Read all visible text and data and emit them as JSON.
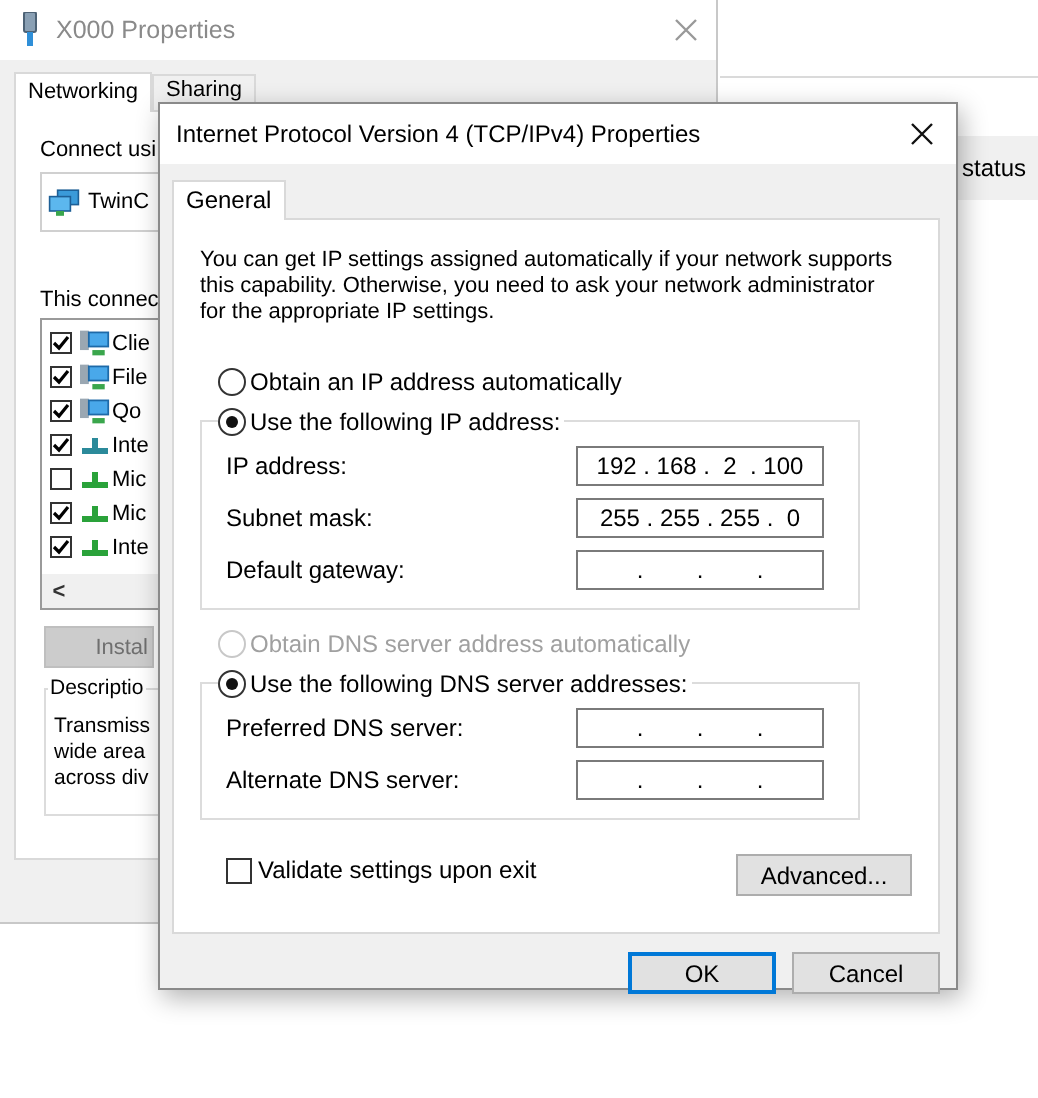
{
  "right_window": {
    "status_text": "status"
  },
  "background_window": {
    "title": "X000 Properties",
    "tabs": [
      {
        "label": "Networking",
        "selected": true
      },
      {
        "label": "Sharing",
        "selected": false
      }
    ],
    "connect_using_label": "Connect usi",
    "adapter": "TwinC",
    "items_label": "This connec",
    "items": [
      {
        "label": "Clie",
        "checked": true,
        "kind": "computer"
      },
      {
        "label": "File",
        "checked": true,
        "kind": "computer"
      },
      {
        "label": "Qo",
        "checked": true,
        "kind": "computer"
      },
      {
        "label": "Inte",
        "checked": true,
        "kind": "network"
      },
      {
        "label": "Mic",
        "checked": false,
        "kind": "network"
      },
      {
        "label": "Mic",
        "checked": true,
        "kind": "network"
      },
      {
        "label": "Inte",
        "checked": true,
        "kind": "network"
      }
    ],
    "scroll_left": "<",
    "install_button": {
      "label": "Instal",
      "disabled": true
    },
    "description": {
      "legend": "Descriptio",
      "lines": [
        "Transmiss",
        "wide area",
        "across div"
      ]
    }
  },
  "dialog": {
    "title": "Internet Protocol Version 4 (TCP/IPv4) Properties",
    "tabs": [
      {
        "label": "General",
        "selected": true
      }
    ],
    "intro": "You can get IP settings assigned automatically if your network supports this capability. Otherwise, you need to ask your network administrator for the appropriate IP settings.",
    "ip_auto": {
      "label": "Obtain an IP address automatically",
      "selected": false,
      "disabled": false
    },
    "ip_manual": {
      "label": "Use the following IP address:",
      "selected": true,
      "disabled": false
    },
    "ip_fields": [
      {
        "label": "IP address:",
        "value": "192 . 168 .  2  . 100"
      },
      {
        "label": "Subnet mask:",
        "value": "255 . 255 . 255 .  0"
      },
      {
        "label": "Default gateway:",
        "value": ".        .        ."
      }
    ],
    "dns_auto": {
      "label": "Obtain DNS server address automatically",
      "selected": false,
      "disabled": true
    },
    "dns_manual": {
      "label": "Use the following DNS server addresses:",
      "selected": true,
      "disabled": false
    },
    "dns_fields": [
      {
        "label": "Preferred DNS server:",
        "value": ".        .        ."
      },
      {
        "label": "Alternate DNS server:",
        "value": ".        .        ."
      }
    ],
    "validate": {
      "label": "Validate settings upon exit",
      "checked": false
    },
    "advanced_button": "Advanced...",
    "buttons": [
      {
        "label": "OK",
        "default": true
      },
      {
        "label": "Cancel",
        "default": false
      }
    ]
  }
}
